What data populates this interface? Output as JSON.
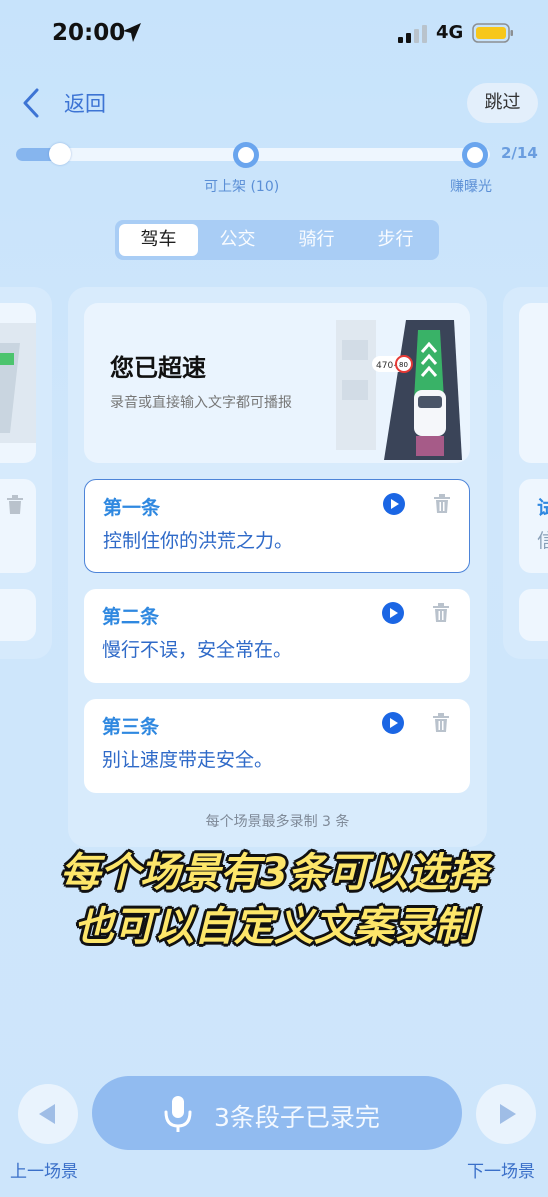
{
  "status_bar": {
    "time": "20:00",
    "network": "4G"
  },
  "nav": {
    "back_label": "返回",
    "skip_label": "跳过"
  },
  "progress": {
    "count": "2/14",
    "fraction": 0.143,
    "milestone_1": "可上架 (10)",
    "milestone_2": "赚曝光"
  },
  "tabs": [
    {
      "label": "驾车",
      "active": true
    },
    {
      "label": "公交",
      "active": false
    },
    {
      "label": "骑行",
      "active": false
    },
    {
      "label": "步行",
      "active": false
    }
  ],
  "scene": {
    "title": "您已超速",
    "subtitle": "录音或直接输入文字都可播报",
    "sign_text": "470+",
    "speed_limit": "80"
  },
  "lines": [
    {
      "number": "第一条",
      "text": "控制住你的洪荒之力。",
      "selected": true
    },
    {
      "number": "第二条",
      "text": "慢行不误，安全常在。",
      "selected": false
    },
    {
      "number": "第三条",
      "text": "别让速度带走安全。",
      "selected": false
    }
  ],
  "max_note": "每个场景最多录制 3 条",
  "side_card_right": {
    "partial_1": "试",
    "partial_2": "信"
  },
  "caption": {
    "line1": "每个场景有3条可以选择",
    "line2": "也可以自定义文案录制"
  },
  "bottom": {
    "record_label": "3条段子已录完",
    "prev_label": "上一场景",
    "next_label": "下一场景"
  },
  "colors": {
    "accent": "#2f88e0",
    "play": "#1b66e4",
    "caption": "#fde66a"
  }
}
